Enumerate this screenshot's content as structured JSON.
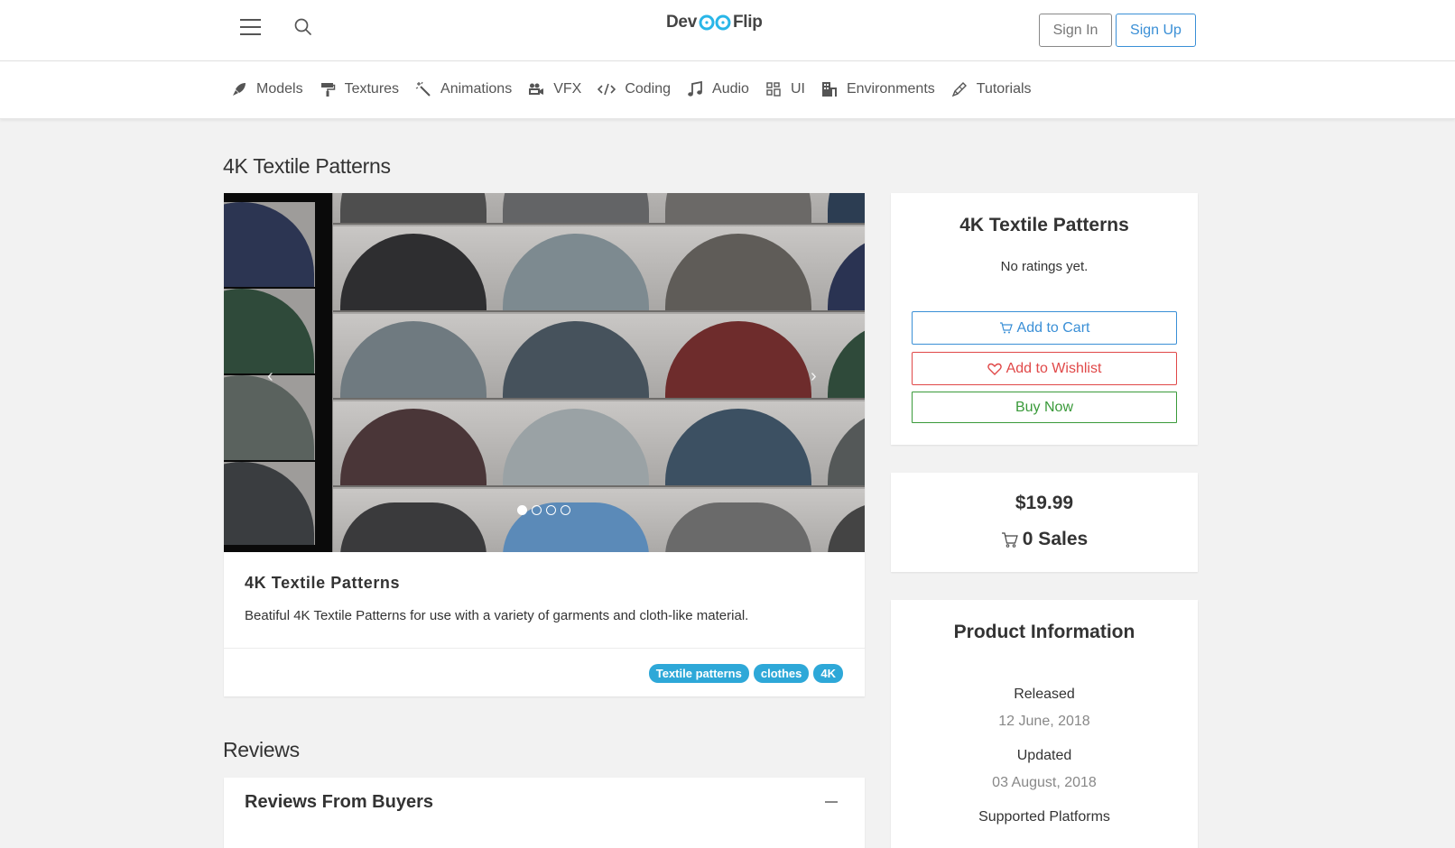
{
  "header": {
    "logo_left": "Dev",
    "logo_right": "Flip",
    "sign_in": "Sign In",
    "sign_up": "Sign Up"
  },
  "categories": [
    {
      "label": "Models",
      "icon": "rocket-icon"
    },
    {
      "label": "Textures",
      "icon": "paint-roller-icon"
    },
    {
      "label": "Animations",
      "icon": "magic-wand-icon"
    },
    {
      "label": "VFX",
      "icon": "video-camera-icon"
    },
    {
      "label": "Coding",
      "icon": "code-icon"
    },
    {
      "label": "Audio",
      "icon": "music-note-icon"
    },
    {
      "label": "UI",
      "icon": "ui-layout-icon"
    },
    {
      "label": "Environments",
      "icon": "building-icon"
    },
    {
      "label": "Tutorials",
      "icon": "pencil-icon"
    }
  ],
  "page": {
    "title": "4K Textile Patterns"
  },
  "product": {
    "card_title": "4K Textile Patterns",
    "description": "Beatiful 4K Textile Patterns for use with a variety of garments and cloth-like material.",
    "tags": [
      "Textile patterns",
      "clothes",
      "4K"
    ],
    "carousel": {
      "prev": "‹",
      "next": "›",
      "slide_count": 4,
      "active_slide": 1
    }
  },
  "buy_box": {
    "title": "4K Textile Patterns",
    "rating_text": "No ratings yet.",
    "add_to_cart": "Add to Cart",
    "add_to_wishlist": "Add to Wishlist",
    "buy_now": "Buy Now"
  },
  "price_box": {
    "price": "$19.99",
    "sales": "0 Sales"
  },
  "product_info": {
    "title": "Product Information",
    "released_label": "Released",
    "released_value": "12 June, 2018",
    "updated_label": "Updated",
    "updated_value": "03 August, 2018",
    "platforms_label": "Supported Platforms"
  },
  "reviews": {
    "heading": "Reviews",
    "card_title": "Reviews From Buyers"
  },
  "colors": {
    "primary": "#3a8fd6",
    "danger": "#e04848",
    "success": "#3a9a3a",
    "tag": "#2ea8d8",
    "logo_accent": "#29b6e8"
  }
}
